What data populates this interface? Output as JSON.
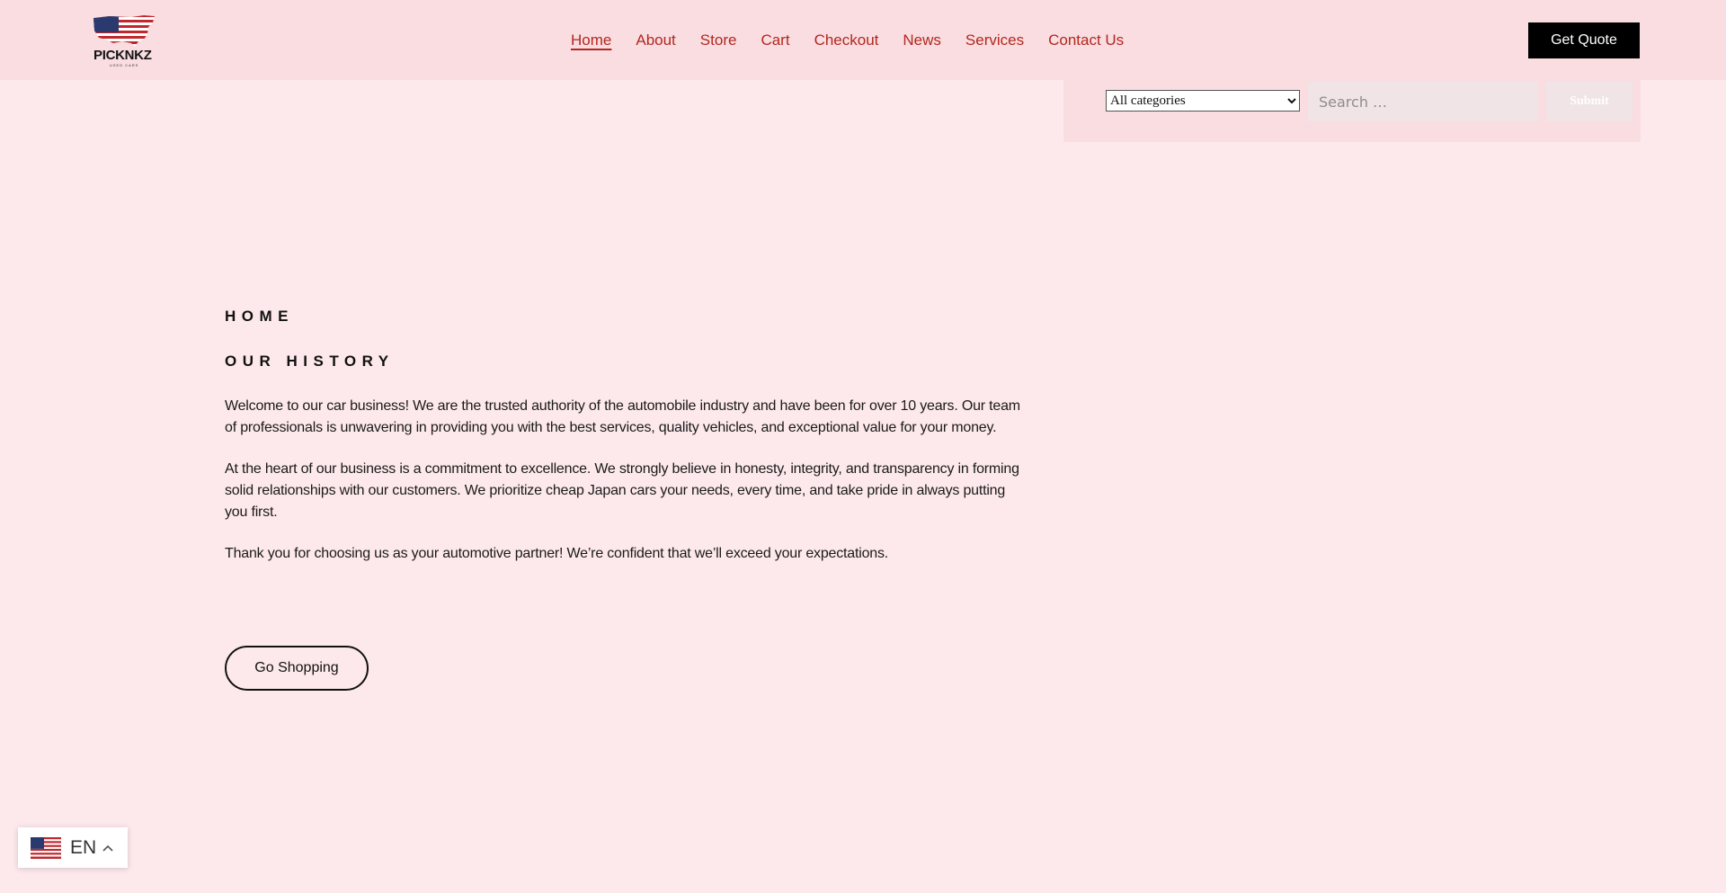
{
  "brand": {
    "name": "PICKNKZ",
    "tagline": "USED CARS"
  },
  "nav": {
    "items": [
      {
        "label": "Home",
        "active": true
      },
      {
        "label": "About"
      },
      {
        "label": "Store"
      },
      {
        "label": "Cart"
      },
      {
        "label": "Checkout"
      },
      {
        "label": "News"
      },
      {
        "label": "Services"
      },
      {
        "label": "Contact Us"
      }
    ],
    "color": "#b3271f"
  },
  "header": {
    "cta_label": "Get Quote"
  },
  "search": {
    "category_selected": "All categories",
    "placeholder": "Search …",
    "submit_label": "Submit"
  },
  "content": {
    "eyebrow": "HOME",
    "heading": "OUR HISTORY",
    "paragraphs": [
      "Welcome to our car business! We are the trusted authority of the automobile industry and have been for over 10 years. Our team of professionals is unwavering in providing you with the best services, quality vehicles, and exceptional value for your money.",
      "At the heart of our business is a commitment to excellence. We strongly believe in honesty, integrity, and transparency in forming solid relationships with our customers. We prioritize cheap Japan cars your needs, every time, and take pride in always putting you first.",
      "Thank you for choosing us as your automotive partner! We’re confident that we’ll exceed your expectations."
    ],
    "cta_label": "Go Shopping"
  },
  "language": {
    "code": "EN",
    "flag_icon": "us-flag-icon",
    "chevron_icon": "chevron-up-icon"
  },
  "colors": {
    "page_bg": "#fde9ec",
    "header_bg": "#f9dde1",
    "accent": "#b3271f"
  }
}
